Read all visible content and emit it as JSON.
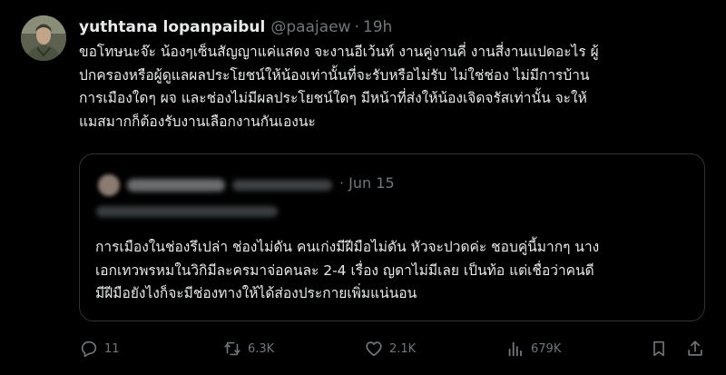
{
  "author": {
    "display_name": "yuthtana lopanpaibul",
    "handle": "@paajaew",
    "separator": "·",
    "time": "19h",
    "avatar_icon": "avatar-icon"
  },
  "tweet": {
    "lines": [
      "ขอโทษนะจ๊ะ น้องๆเซ็นสัญญาแค่แสดง จะงานอีเว้นท์ งานคู่งานคี่ งานสี่งานแปดอะไร ผู้",
      "ปกครองหรือผู้ดูแลผลประโยชน์ให้น้องเท่านั้นที่จะรับหรือไม่รับ ไม่ใช่ช่อง ไม่มีการบ้าน",
      "การเมืองใดๆ ผจ และช่องไม่มีผลประโยชน์ใดๆ มีหน้าที่ส่งให้น้องเจิดจรัสเท่านั้น จะให้",
      "แมสมากก็ต้องรับงานเลือกงานกันเองนะ"
    ]
  },
  "quote": {
    "date": "· Jun 15",
    "lines": [
      "การเมืองในช่องรึเปล่า ช่องไม่ดัน คนเก่งมีฝีมือไม่ดัน หัวจะปวดค่ะ ชอบคู่นี้มากๆ นาง",
      "เอกเทวพรหมในวิกิมีละครมาจ่อคนละ 2-4 เรื่อง ญดาไม่มีเลย เป็นท้อ แต่เชื่อว่าคนดี",
      "มีฝีมือยังไงก็จะมีช่องทางให้ได้ส่องประกายเพิ่มแน่นอน"
    ]
  },
  "actions": {
    "replies": "11",
    "reposts": "6.3K",
    "likes": "2.1K",
    "views": "679K"
  },
  "colors": {
    "background": "#000000",
    "text": "#e7e9ea",
    "muted": "#71767b",
    "border": "#2f3336"
  }
}
